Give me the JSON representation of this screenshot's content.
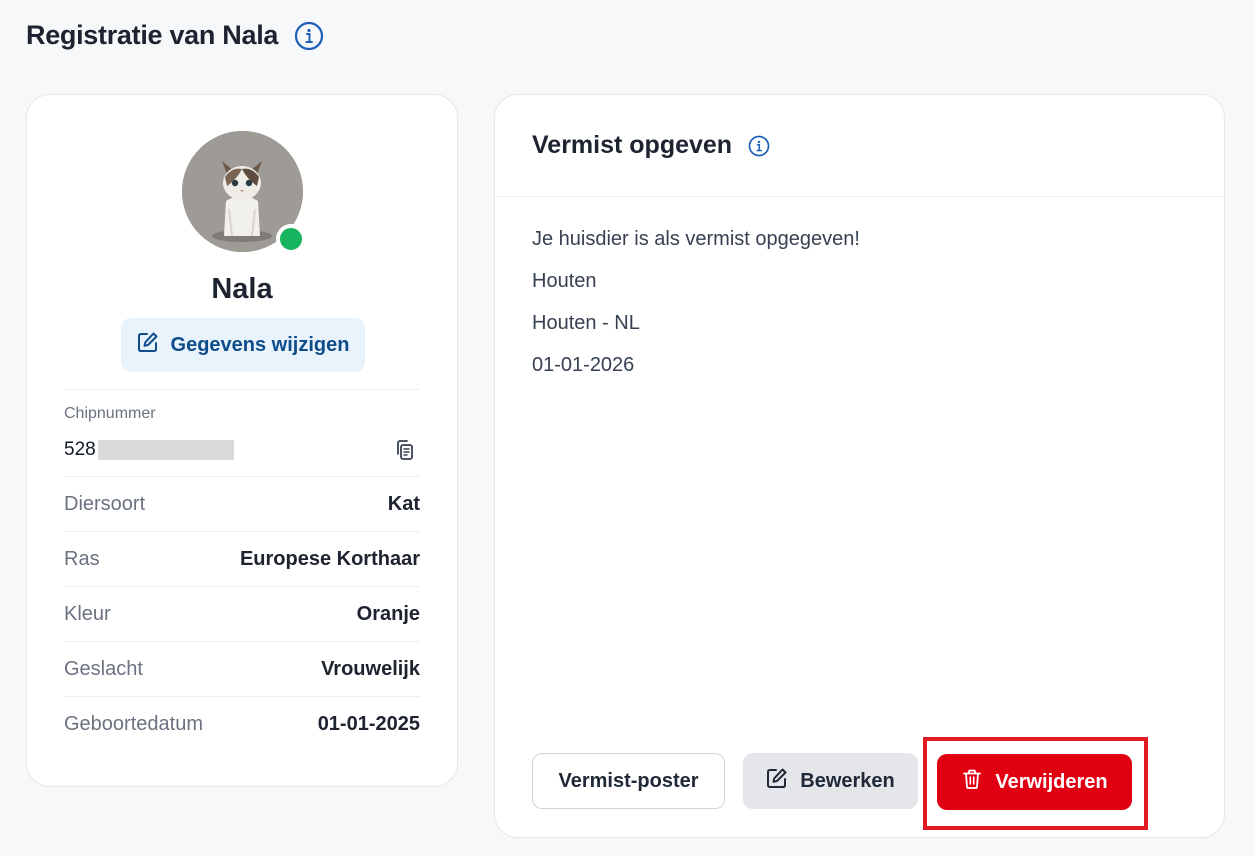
{
  "page": {
    "title": "Registratie van Nala"
  },
  "pet": {
    "name": "Nala",
    "edit_label": "Gegevens wijzigen",
    "status_color": "#16b45e",
    "chip": {
      "label": "Chipnummer",
      "value_prefix": "528"
    },
    "details": [
      {
        "label": "Diersoort",
        "value": "Kat"
      },
      {
        "label": "Ras",
        "value": "Europese Korthaar"
      },
      {
        "label": "Kleur",
        "value": "Oranje"
      },
      {
        "label": "Geslacht",
        "value": "Vrouwelijk"
      },
      {
        "label": "Geboortedatum",
        "value": "01-01-2025"
      }
    ]
  },
  "missing": {
    "title": "Vermist opgeven",
    "lines": [
      "Je huisdier is als vermist opgegeven!",
      "Houten",
      "Houten - NL",
      "01-01-2026"
    ],
    "buttons": {
      "poster": "Vermist-poster",
      "edit": "Bewerken",
      "delete": "Verwijderen"
    }
  },
  "colors": {
    "accent_blue": "#1d5fb8",
    "delete_red": "#e00012",
    "highlight_red": "#e01b24"
  }
}
